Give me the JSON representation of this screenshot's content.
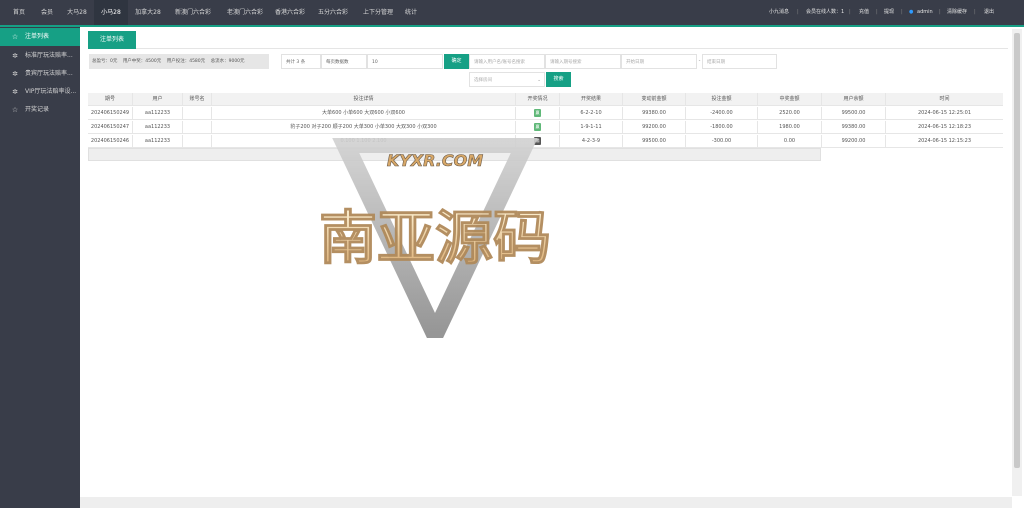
{
  "topnav": {
    "items": [
      "首页",
      "会员",
      "大马28",
      "小马28",
      "加拿大28",
      "新澳门六合彩",
      "老澳门六合彩",
      "香港六合彩",
      "五分六合彩",
      "上下分管理",
      "统计"
    ],
    "right": {
      "sound": "小九消息",
      "online": "会员在线人数：1",
      "recharge": "充值",
      "withdraw": "提现",
      "user": "admin",
      "clear_cache": "清除缓存",
      "logout": "退出",
      "sep": "|"
    }
  },
  "sidebar": {
    "items": [
      {
        "icon": "☆",
        "label": "注单列表"
      },
      {
        "icon": "✲",
        "label": "标准厅玩法赔率..."
      },
      {
        "icon": "✲",
        "label": "贵宾厅玩法赔率..."
      },
      {
        "icon": "✲",
        "label": "VIP厅玩法赔率设..."
      },
      {
        "icon": "☆",
        "label": "开奖记录"
      }
    ]
  },
  "tab": "注单列表",
  "summary": {
    "bets": "总盈亏：0元",
    "user_win": "用户中奖：4500元",
    "user_bet": "用户投注：4580元",
    "profit": "总流水：9000元"
  },
  "filters": {
    "total": "共计 3 条",
    "per_page_label": "每页数据数",
    "per_page": "10",
    "confirm": "确定",
    "user_placeholder": "请输入用户名/账号名搜索",
    "period_placeholder": "请输入期号搜索",
    "start_placeholder": "开始日期",
    "dash": "-",
    "end_placeholder": "结束日期",
    "room_placeholder": "选择房间",
    "search": "搜索"
  },
  "table": {
    "headers": [
      "期号",
      "用户",
      "账号名",
      "投注详情",
      "开奖情况",
      "开奖结果",
      "变动前金额",
      "投注金额",
      "中奖金额",
      "用户余额",
      "时间"
    ],
    "rows": [
      {
        "period": "202406150249",
        "user": "aa112233",
        "account": "",
        "detail": "大单600 小单600 大双600 小双600",
        "status": "赢",
        "status_color": "#5fb878",
        "result": "6-2-2-10",
        "before": "99380.00",
        "bet": "-2400.00",
        "win": "2520.00",
        "balance": "99500.00",
        "time": "2024-06-15 12:25:01"
      },
      {
        "period": "202406150247",
        "user": "aa112233",
        "account": "",
        "detail": "豹子200 对子200 顺子200 大单300 小单300 大双300 小双300",
        "status": "赢",
        "status_color": "#5fb878",
        "result": "1-9-1-11",
        "before": "99200.00",
        "bet": "-1800.00",
        "win": "1980.00",
        "balance": "99380.00",
        "time": "2024-06-15 12:18:23"
      },
      {
        "period": "202406150246",
        "user": "aa112233",
        "account": "",
        "detail": "0.100 1.100 2.100",
        "status": "输",
        "status_color": "#555555",
        "result": "4-2-3-9",
        "before": "99500.00",
        "bet": "-300.00",
        "win": "0.00",
        "balance": "99200.00",
        "time": "2024-06-15 12:15:23"
      }
    ]
  },
  "watermark": {
    "top": "KYXR.COM",
    "main": "南亚源码"
  },
  "colors": {
    "accent": "#16a085",
    "nav_bg": "#393d49"
  }
}
